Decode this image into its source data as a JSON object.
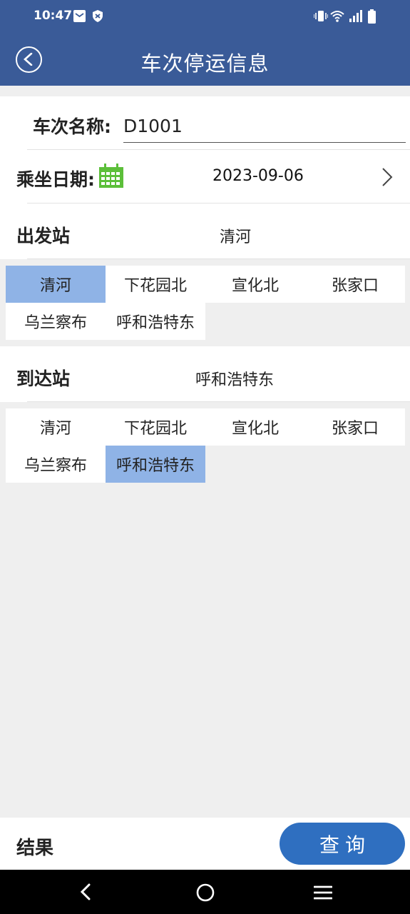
{
  "status": {
    "time": "10:47"
  },
  "header": {
    "title": "车次停运信息"
  },
  "form": {
    "train_label": "车次名称:",
    "train_value": "D1001",
    "date_label": "乘坐日期:",
    "date_value": "2023-09-06",
    "departure_label": "出发站",
    "departure_value": "清河",
    "arrival_label": "到达站",
    "arrival_value": "呼和浩特东"
  },
  "departure_stations": [
    "清河",
    "下花园北",
    "宣化北",
    "张家口",
    "乌兰察布",
    "呼和浩特东"
  ],
  "departure_selected_index": 0,
  "arrival_stations": [
    "清河",
    "下花园北",
    "宣化北",
    "张家口",
    "乌兰察布",
    "呼和浩特东"
  ],
  "arrival_selected_index": 5,
  "footer": {
    "result_label": "结果",
    "query_button": "查询"
  },
  "colors": {
    "header_bg": "#3a5b98",
    "selected_cell": "#8fb3e6",
    "query_button": "#2f6fc0",
    "calendar_icon": "#5cbf3a"
  }
}
